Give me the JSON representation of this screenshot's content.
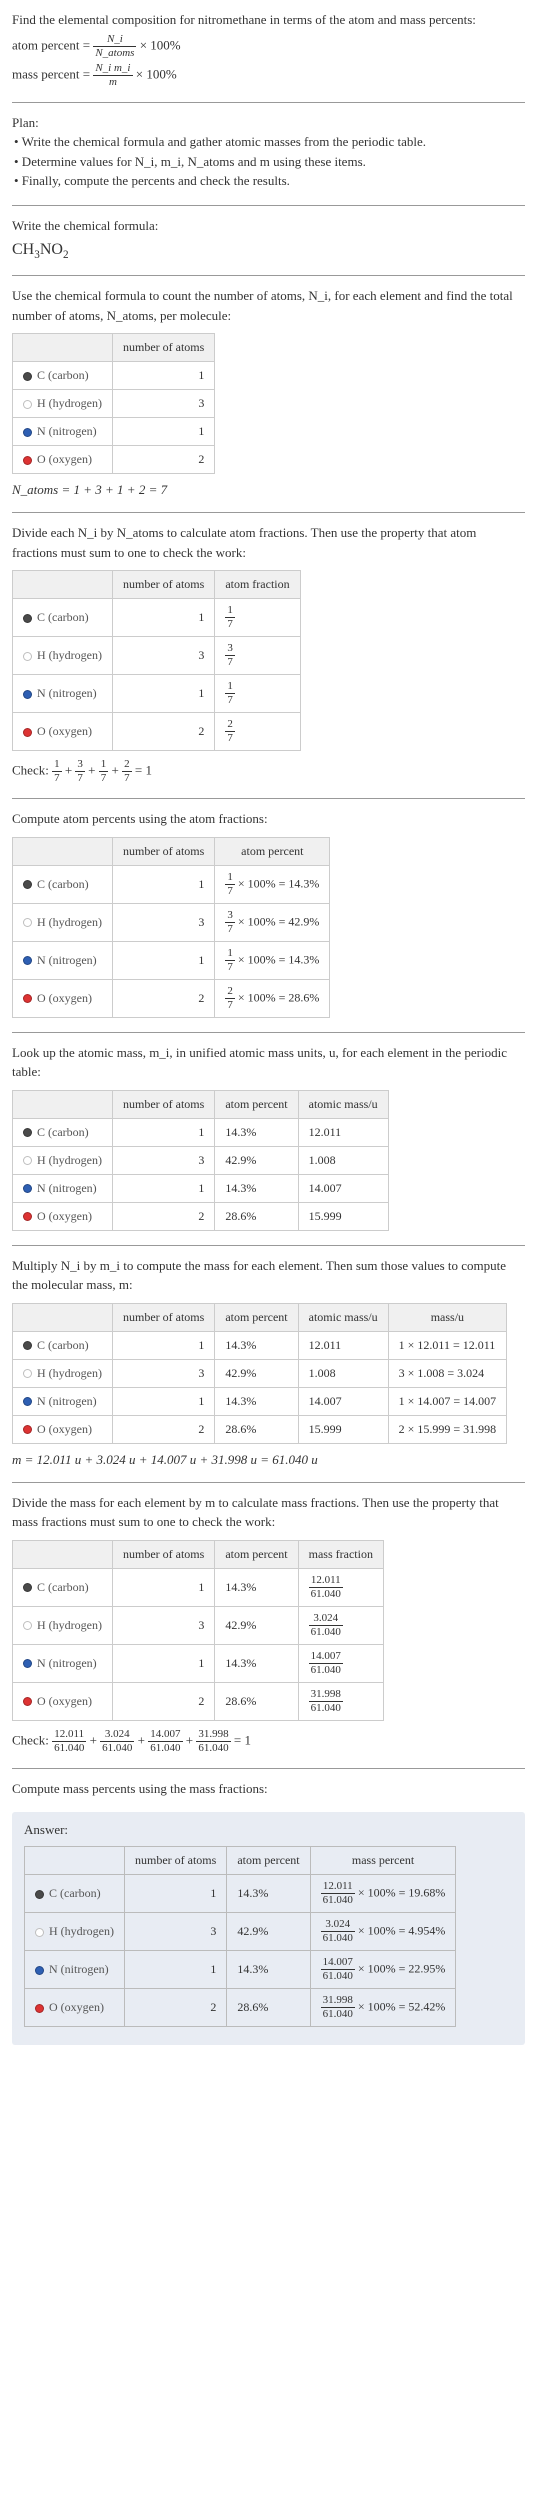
{
  "intro": {
    "line1": "Find the elemental composition for nitromethane in terms of the atom and mass percents:",
    "ap_label": "atom percent =",
    "ap_num": "N_i",
    "ap_den": "N_atoms",
    "times100": "× 100%",
    "mp_label": "mass percent =",
    "mp_num": "N_i m_i",
    "mp_den": "m"
  },
  "plan": {
    "header": "Plan:",
    "b1": "• Write the chemical formula and gather atomic masses from the periodic table.",
    "b2": "• Determine values for N_i, m_i, N_atoms and m using these items.",
    "b3": "• Finally, compute the percents and check the results."
  },
  "formula_block": {
    "text": "Write the chemical formula:",
    "formula_main": "CH",
    "sub1": "3",
    "mid": "NO",
    "sub2": "2"
  },
  "count_block": {
    "text1": "Use the chemical formula to count the number of atoms, N_i, for each element and find the total number of atoms, N_atoms, per molecule:",
    "col_atoms": "number of atoms",
    "natoms_eq": "N_atoms = 1 + 3 + 1 + 2 = 7"
  },
  "elements": [
    {
      "name": "C (carbon)",
      "color": "#4a4a4a",
      "n": "1"
    },
    {
      "name": "H (hydrogen)",
      "color": "#ffffff",
      "n": "3"
    },
    {
      "name": "N (nitrogen)",
      "color": "#2e5fb3",
      "n": "1"
    },
    {
      "name": "O (oxygen)",
      "color": "#d33",
      "n": "2"
    }
  ],
  "frac_block": {
    "text": "Divide each N_i by N_atoms to calculate atom fractions. Then use the property that atom fractions must sum to one to check the work:",
    "col_frac": "atom fraction",
    "fracs": [
      [
        "1",
        "7"
      ],
      [
        "3",
        "7"
      ],
      [
        "1",
        "7"
      ],
      [
        "2",
        "7"
      ]
    ],
    "check_label": "Check:",
    "check_eq_parts": [
      "1",
      "7",
      "+",
      "3",
      "7",
      "+",
      "1",
      "7",
      "+",
      "2",
      "7",
      "= 1"
    ]
  },
  "atom_pct_block": {
    "text": "Compute atom percents using the atom fractions:",
    "col_pct": "atom percent",
    "pcts": [
      "= 14.3%",
      "= 42.9%",
      "= 14.3%",
      "= 28.6%"
    ],
    "fracs": [
      [
        "1",
        "7"
      ],
      [
        "3",
        "7"
      ],
      [
        "1",
        "7"
      ],
      [
        "2",
        "7"
      ]
    ],
    "times": "× 100%"
  },
  "mass_lookup": {
    "text": "Look up the atomic mass, m_i, in unified atomic mass units, u, for each element in the periodic table:",
    "col_mass": "atomic mass/u",
    "pcts": [
      "14.3%",
      "42.9%",
      "14.3%",
      "28.6%"
    ],
    "masses": [
      "12.011",
      "1.008",
      "14.007",
      "15.999"
    ]
  },
  "mol_mass": {
    "text": "Multiply N_i by m_i to compute the mass for each element. Then sum those values to compute the molecular mass, m:",
    "col_massu": "mass/u",
    "calcs": [
      "1 × 12.011 = 12.011",
      "3 × 1.008 = 3.024",
      "1 × 14.007 = 14.007",
      "2 × 15.999 = 31.998"
    ],
    "pcts": [
      "14.3%",
      "42.9%",
      "14.3%",
      "28.6%"
    ],
    "masses": [
      "12.011",
      "1.008",
      "14.007",
      "15.999"
    ],
    "m_eq": "m = 12.011 u + 3.024 u + 14.007 u + 31.998 u = 61.040 u"
  },
  "mass_frac": {
    "text": "Divide the mass for each element by m to calculate mass fractions. Then use the property that mass fractions must sum to one to check the work:",
    "col_mfrac": "mass fraction",
    "nums": [
      "12.011",
      "3.024",
      "14.007",
      "31.998"
    ],
    "den": "61.040",
    "pcts": [
      "14.3%",
      "42.9%",
      "14.3%",
      "28.6%"
    ],
    "check_label": "Check:",
    "check_end": "= 1"
  },
  "mass_pct": {
    "text": "Compute mass percents using the mass fractions:"
  },
  "answer": {
    "label": "Answer:",
    "col_mpct": "mass percent",
    "nums": [
      "12.011",
      "3.024",
      "14.007",
      "31.998"
    ],
    "den": "61.040",
    "pcts": [
      "14.3%",
      "42.9%",
      "14.3%",
      "28.6%"
    ],
    "times": "× 100%",
    "results": [
      "= 19.68%",
      "= 4.954%",
      "= 22.95%",
      "= 52.42%"
    ]
  },
  "chart_data": [
    {
      "type": "table",
      "title": "atoms per molecule",
      "categories": [
        "C",
        "H",
        "N",
        "O"
      ],
      "values": [
        1,
        3,
        1,
        2
      ]
    },
    {
      "type": "table",
      "title": "atom percent",
      "categories": [
        "C",
        "H",
        "N",
        "O"
      ],
      "values": [
        14.3,
        42.9,
        14.3,
        28.6
      ]
    },
    {
      "type": "table",
      "title": "atomic mass (u)",
      "categories": [
        "C",
        "H",
        "N",
        "O"
      ],
      "values": [
        12.011,
        1.008,
        14.007,
        15.999
      ]
    },
    {
      "type": "table",
      "title": "element mass (u)",
      "categories": [
        "C",
        "H",
        "N",
        "O"
      ],
      "values": [
        12.011,
        3.024,
        14.007,
        31.998
      ]
    },
    {
      "type": "table",
      "title": "mass percent",
      "categories": [
        "C",
        "H",
        "N",
        "O"
      ],
      "values": [
        19.68,
        4.954,
        22.95,
        52.42
      ]
    }
  ]
}
